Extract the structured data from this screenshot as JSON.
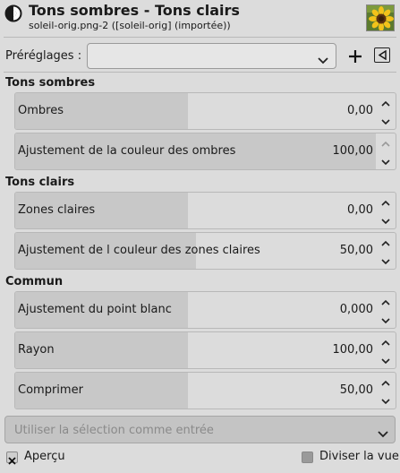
{
  "header": {
    "title": "Tons sombres - Tons clairs",
    "subtitle": "soleil-orig.png-2 ([soleil-orig] (importée))",
    "tool_icon": "shadows-highlights-icon",
    "thumbnail_icon": "sunflower-thumbnail"
  },
  "presets": {
    "label": "Préréglages :",
    "value": "",
    "add_icon": "plus-icon",
    "menu_icon": "triangle-menu-icon"
  },
  "sections": {
    "shadows": {
      "title": "Tons sombres",
      "sliders": [
        {
          "label": "Ombres",
          "value": "0,00",
          "fraction": 0.48
        },
        {
          "label": "Ajustement de la couleur des ombres",
          "value": "100,00",
          "fraction": 1.0
        }
      ]
    },
    "highlights": {
      "title": "Tons clairs",
      "sliders": [
        {
          "label": "Zones claires",
          "value": "0,00",
          "fraction": 0.48
        },
        {
          "label": "Ajustement de l couleur des zones claires",
          "value": "50,00",
          "fraction": 0.5
        }
      ]
    },
    "common": {
      "title": "Commun",
      "sliders": [
        {
          "label": "Ajustement du point blanc",
          "value": "0,000",
          "fraction": 0.48
        },
        {
          "label": "Rayon",
          "value": "100,00",
          "fraction": 0.48
        },
        {
          "label": "Comprimer",
          "value": "50,00",
          "fraction": 0.48
        }
      ]
    }
  },
  "selection_input": {
    "text": "Utiliser la sélection comme entrée"
  },
  "footer": {
    "preview_label": "Aperçu",
    "preview_checked": true,
    "split_label": "Diviser la vue",
    "split_checked": false
  }
}
